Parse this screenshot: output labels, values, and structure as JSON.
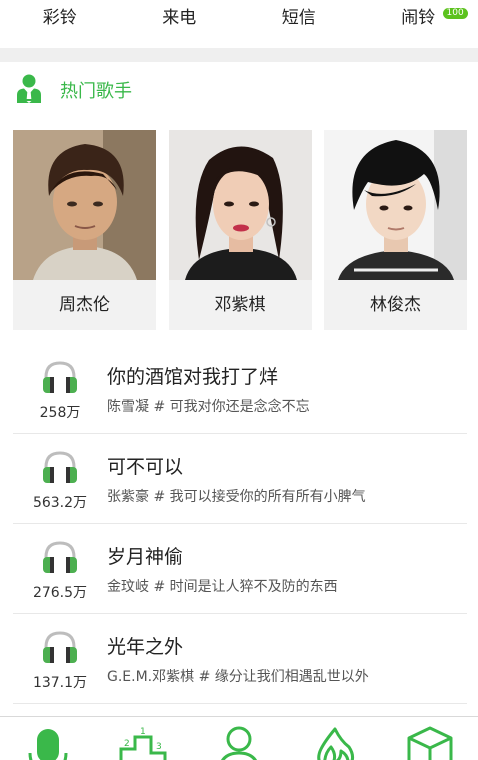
{
  "top_tabs": [
    {
      "label": "彩铃"
    },
    {
      "label": "来电"
    },
    {
      "label": "短信"
    },
    {
      "label": "闹铃",
      "badge": "100"
    }
  ],
  "section": {
    "title": "热门歌手",
    "icon": "singer-icon"
  },
  "singers": [
    {
      "name": "周杰伦"
    },
    {
      "name": "邓紫棋"
    },
    {
      "name": "林俊杰"
    }
  ],
  "songs": [
    {
      "title": "你的酒馆对我打了烊",
      "subtitle": "陈雪凝 # 可我对你还是念念不忘",
      "count": "258万"
    },
    {
      "title": "可不可以",
      "subtitle": "张紫豪 # 我可以接受你的所有所有小脾气",
      "count": "563.2万"
    },
    {
      "title": "岁月神偷",
      "subtitle": "金玟岐 # 时间是让人猝不及防的东西",
      "count": "276.5万"
    },
    {
      "title": "光年之外",
      "subtitle": "G.E.M.邓紫棋 # 缘分让我们相遇乱世以外",
      "count": "137.1万"
    }
  ],
  "bottom_nav": [
    {
      "icon": "microphone-icon"
    },
    {
      "icon": "podium-icon"
    },
    {
      "icon": "user-icon"
    },
    {
      "icon": "flame-icon"
    },
    {
      "icon": "box-icon"
    }
  ],
  "colors": {
    "accent": "#3ab84a",
    "headphone": "#4caf50",
    "badge": "#5cc21e"
  }
}
